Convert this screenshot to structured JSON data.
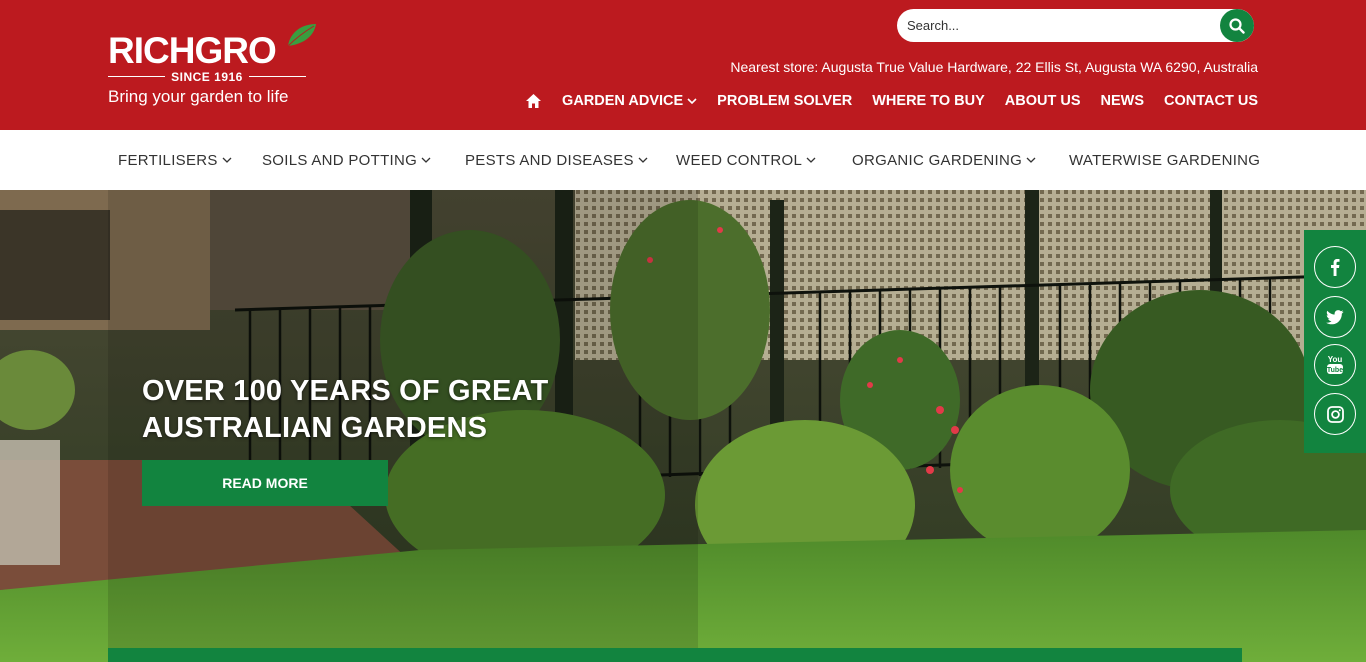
{
  "brand": {
    "name": "RICHGRO",
    "since": "SINCE 1916",
    "tagline": "Bring your garden to life",
    "color": "#bc1a1f",
    "accent": "#12843f"
  },
  "search": {
    "placeholder": "Search...",
    "icon": "search-icon"
  },
  "nearest_store": "Nearest store: Augusta True Value Hardware, 22 Ellis St, Augusta WA 6290, Australia",
  "main_nav": {
    "home_icon": "home-icon",
    "items": [
      {
        "label": "GARDEN ADVICE",
        "dropdown": true
      },
      {
        "label": "PROBLEM SOLVER",
        "dropdown": false
      },
      {
        "label": "WHERE TO BUY",
        "dropdown": false
      },
      {
        "label": "ABOUT US",
        "dropdown": false
      },
      {
        "label": "NEWS",
        "dropdown": false
      },
      {
        "label": "CONTACT US",
        "dropdown": false
      }
    ]
  },
  "categories": [
    {
      "label": "FERTILISERS",
      "dropdown": true
    },
    {
      "label": "SOILS AND POTTING",
      "dropdown": true
    },
    {
      "label": "PESTS AND DISEASES",
      "dropdown": true
    },
    {
      "label": "WEED CONTROL",
      "dropdown": true
    },
    {
      "label": "ORGANIC GARDENING",
      "dropdown": true
    },
    {
      "label": "WATERWISE GARDENING",
      "dropdown": false
    }
  ],
  "hero": {
    "title_line1": "OVER 100 YEARS OF GREAT",
    "title_line2": "AUSTRALIAN GARDENS",
    "button": "READ MORE"
  },
  "social": [
    "facebook-icon",
    "twitter-icon",
    "youtube-icon",
    "instagram-icon"
  ],
  "social_youtube_text": "You Tube"
}
